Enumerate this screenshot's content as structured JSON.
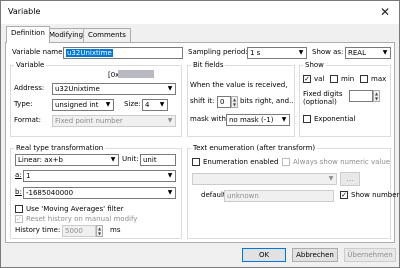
{
  "window": {
    "title": "Variable"
  },
  "tabs": [
    "Definition",
    "Modifying",
    "Comments"
  ],
  "top": {
    "variable_name_label": "Variable name:",
    "variable_name_value": "u32Unixtime",
    "sampling_label": "Sampling period:",
    "sampling_value": "1 s",
    "show_as_label": "Show as:",
    "show_as_value": "REAL"
  },
  "variable": {
    "title": "Variable",
    "address_hex": "[0x",
    "address_label": "Address:",
    "address_value": "u32Unixtime",
    "type_label": "Type:",
    "type_value": "unsigned int",
    "size_label": "Size:",
    "size_value": "4",
    "format_label": "Format:",
    "format_value": "Fixed point number"
  },
  "bitfields": {
    "title": "Bit fields",
    "line1": "When the value is received,",
    "shift_label": "shift it:",
    "shift_value": "0",
    "shift_suffix": "bits right, and..",
    "mask_label": "mask with:",
    "mask_value": "no mask (-1)"
  },
  "show": {
    "title": "Show",
    "val": "val",
    "min": "min",
    "max": "max",
    "fixed_digits": "Fixed digits",
    "optional": "(optional)",
    "exponential": "Exponential"
  },
  "realtype": {
    "title": "Real type transformation",
    "transform_value": "Linear: ax+b",
    "unit_label": "Unit:",
    "unit_value": "unit",
    "a_label": "a:",
    "a_value": "1",
    "b_label": "b:",
    "b_value": "-1685040000",
    "moving_avg": "Use 'Moving Averages' filter",
    "reset_history": "Reset history on manual modify",
    "history_label": "History time:",
    "history_value": "5000",
    "history_unit": "ms"
  },
  "textenum": {
    "title": "Text enumeration (after transform)",
    "enum_enabled": "Enumeration enabled",
    "always_show": "Always show numeric value",
    "default_label": "default:",
    "default_value": "unknown",
    "show_number": "Show number"
  },
  "buttons": {
    "ok": "OK",
    "cancel": "Abbrechen",
    "apply": "Übernehmen"
  }
}
